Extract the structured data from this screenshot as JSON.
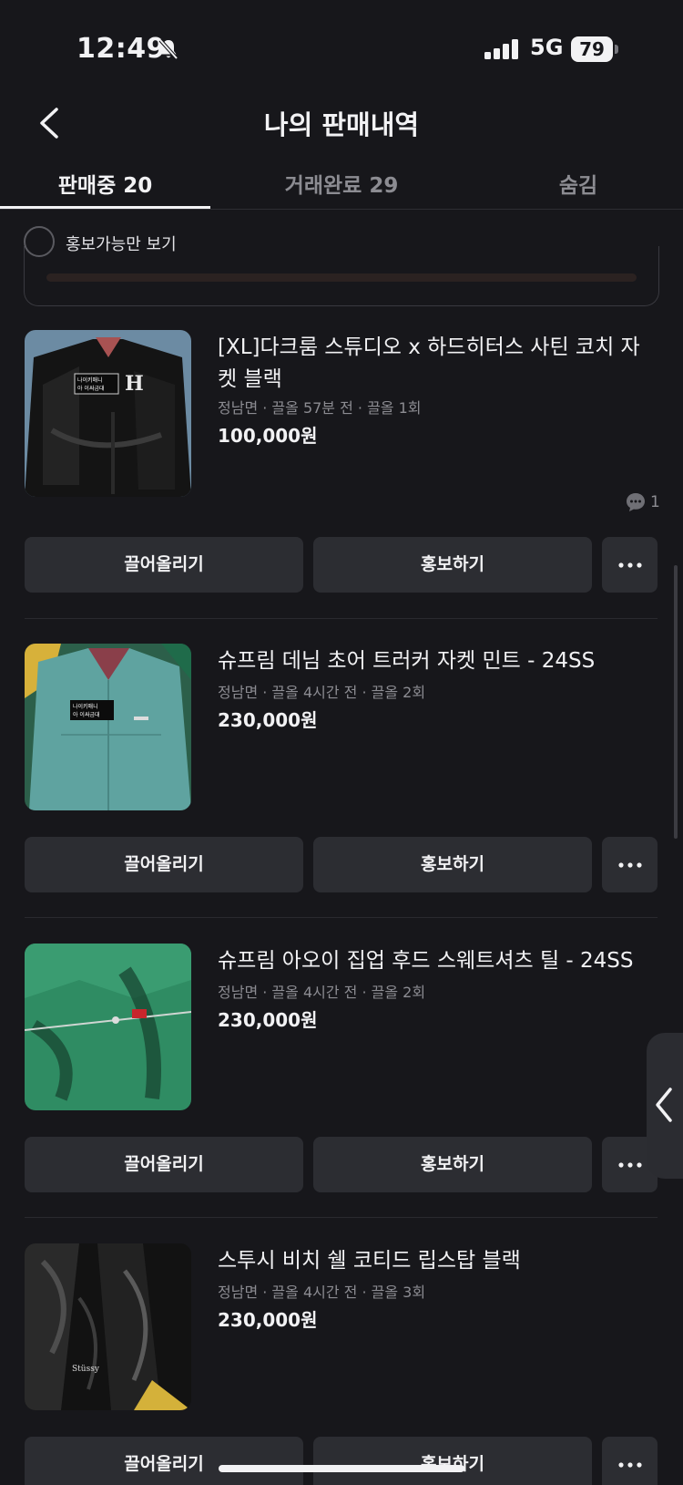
{
  "status_bar": {
    "time": "12:49",
    "network": "5G",
    "battery": "79",
    "icons": [
      "bell-slash-icon",
      "signal-icon",
      "battery-icon"
    ]
  },
  "header": {
    "title": "나의 판매내역",
    "back_icon": "chevron-left-icon"
  },
  "tabs": [
    {
      "label": "판매중 20",
      "selected": true
    },
    {
      "label": "거래완료 29",
      "selected": false
    },
    {
      "label": "숨김",
      "selected": false
    }
  ],
  "filter": {
    "label": "홍보가능만 보기",
    "checked": false
  },
  "items": [
    {
      "title": "[XL]다크룸 스튜디오 x 하드히터스 사틴 코치 자켓 블랙",
      "meta": "정남면 · 끌올 57분 전 · 끌올 1회",
      "price": "100,000원",
      "chat_count": "1",
      "thumb_label": "나이키매니\n아 이싸금대"
    },
    {
      "title": "슈프림 데님 초어 트러커 자켓 민트 - 24SS",
      "meta": "정남면 · 끌올 4시간 전 · 끌올 2회",
      "price": "230,000원",
      "thumb_label": "나이키매니\n아 이싸금대"
    },
    {
      "title": "슈프림 아오이 집업 후드 스웨트셔츠 틸 - 24SS",
      "meta": "정남면 · 끌올 4시간 전 · 끌올 2회",
      "price": "230,000원"
    },
    {
      "title": "스투시 비치 쉘 코티드 립스탑 블랙",
      "meta": "정남면 · 끌올 4시간 전 · 끌올 3회",
      "price": "230,000원"
    }
  ],
  "buttons": {
    "bump": "끌어올리기",
    "promote": "홍보하기",
    "more_icon": "more-horizontal-icon"
  },
  "colors": {
    "background": "#17171b",
    "button": "#2c2d32",
    "text": "#f2f2f4",
    "muted": "#8c8c92"
  }
}
